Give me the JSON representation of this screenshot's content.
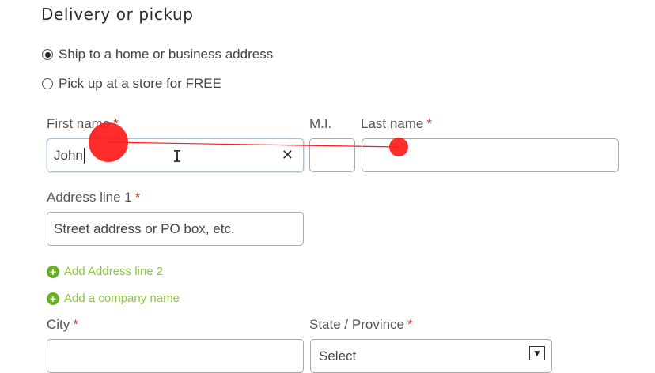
{
  "section_title": "Delivery or pickup",
  "delivery_options": [
    {
      "label": "Ship to a home or business address",
      "selected": true
    },
    {
      "label": "Pick up at a store for FREE",
      "selected": false
    }
  ],
  "fields": {
    "first_name": {
      "label": "First name",
      "value": "John"
    },
    "mi": {
      "label": "M.I."
    },
    "last_name": {
      "label": "Last name"
    },
    "address1": {
      "label": "Address line 1",
      "placeholder": "Street address or PO box, etc."
    },
    "city": {
      "label": "City"
    },
    "state": {
      "label": "State / Province",
      "value": "Select"
    }
  },
  "required_mark": "*",
  "links": {
    "add_address_line_2": "Add Address line 2",
    "add_company_name": "Add a company name"
  },
  "icons": {
    "clear": "close-icon",
    "plus": "plus-circle-icon",
    "chevron": "chevron-down-icon",
    "cursor": "text-cursor-icon"
  },
  "colors": {
    "accent_green": "#8cc63f",
    "required_red": "#c0392b",
    "focus_blue": "#9cc3e6",
    "gesture_red": "#ff1a1a"
  }
}
